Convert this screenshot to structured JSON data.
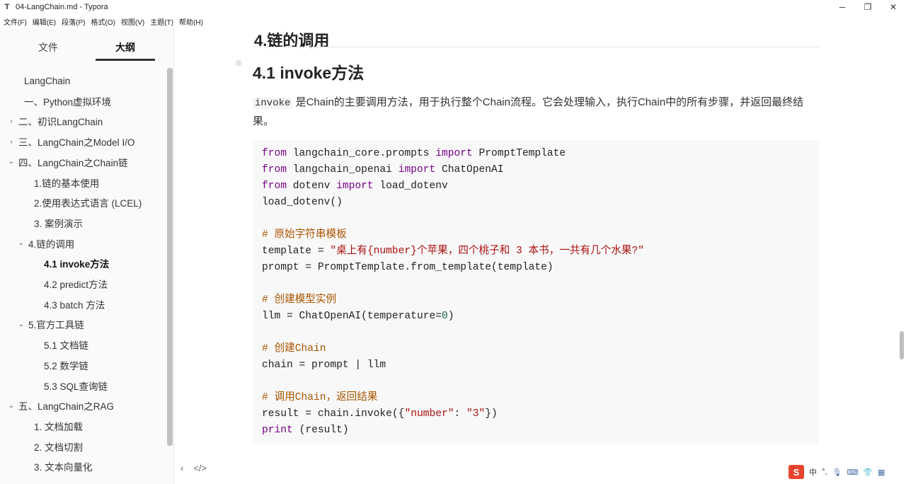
{
  "window": {
    "title": "04-LangChain.md - Typora",
    "app_icon": "T",
    "controls": [
      "minimize-icon",
      "maximize-icon",
      "close-icon"
    ]
  },
  "menubar": [
    "文件(F)",
    "编辑(E)",
    "段落(P)",
    "格式(O)",
    "视图(V)",
    "主题(T)",
    "帮助(H)"
  ],
  "sidebar": {
    "tabs": {
      "file": "文件",
      "outline": "大纲",
      "active": "outline"
    },
    "outline": [
      {
        "label": "LangChain",
        "level": 0,
        "chevron": ""
      },
      {
        "label": "一、Python虚拟环境",
        "level": 0,
        "chevron": ""
      },
      {
        "label": "二、初识LangChain",
        "level": 0,
        "chevron": "›"
      },
      {
        "label": "三、LangChain之Model I/O",
        "level": 0,
        "chevron": "›"
      },
      {
        "label": "四、LangChain之Chain链",
        "level": 0,
        "chevron": "⌄"
      },
      {
        "label": "1.链的基本使用",
        "level": 1,
        "chevron": ""
      },
      {
        "label": "2.使用表达式语言 (LCEL)",
        "level": 1,
        "chevron": ""
      },
      {
        "label": "3. 案例演示",
        "level": 1,
        "chevron": ""
      },
      {
        "label": "4.链的调用",
        "level": 1,
        "chevron": "⌄"
      },
      {
        "label": "4.1 invoke方法",
        "level": 2,
        "chevron": "",
        "active": true
      },
      {
        "label": "4.2 predict方法",
        "level": 2,
        "chevron": ""
      },
      {
        "label": "4.3 batch 方法",
        "level": 2,
        "chevron": ""
      },
      {
        "label": "5.官方工具链",
        "level": 1,
        "chevron": "⌄"
      },
      {
        "label": "5.1 文档链",
        "level": 2,
        "chevron": ""
      },
      {
        "label": "5.2 数学链",
        "level": 2,
        "chevron": ""
      },
      {
        "label": "5.3 SQL查询链",
        "level": 2,
        "chevron": ""
      },
      {
        "label": "五、LangChain之RAG",
        "level": 0,
        "chevron": "⌄"
      },
      {
        "label": "1. 文档加载",
        "level": 1,
        "chevron": ""
      },
      {
        "label": "2. 文档切割",
        "level": 1,
        "chevron": ""
      },
      {
        "label": "3. 文本向量化",
        "level": 1,
        "chevron": ""
      }
    ]
  },
  "doc": {
    "h1": "4.链的调用",
    "h2": "4.1 invoke方法",
    "para_code": "invoke",
    "para_text": " 是Chain的主要调用方法，用于执行整个Chain流程。它会处理输入，执行Chain中的所有步骤，并返回最终结果。",
    "code": [
      [
        [
          "kw",
          "from"
        ],
        [
          "",
          "langchain_core.prompts "
        ],
        [
          "kw",
          "import"
        ],
        [
          "",
          "PromptTemplate"
        ]
      ],
      [
        [
          "kw",
          "from"
        ],
        [
          "",
          "langchain_openai "
        ],
        [
          "kw",
          "import"
        ],
        [
          "",
          "ChatOpenAI"
        ]
      ],
      [
        [
          "kw",
          "from"
        ],
        [
          "",
          "dotenv "
        ],
        [
          "kw",
          "import"
        ],
        [
          "",
          "load_dotenv"
        ]
      ],
      [
        [
          "",
          "load_dotenv()"
        ]
      ],
      [],
      [
        [
          "cmt",
          "# 原始字符串模板"
        ]
      ],
      [
        [
          "",
          "template = "
        ],
        [
          "str",
          "\"桌上有{number}个苹果，四个桃子和 3 本书，一共有几个水果?\""
        ]
      ],
      [
        [
          "",
          "prompt = PromptTemplate.from_template(template)"
        ]
      ],
      [],
      [
        [
          "cmt",
          "# 创建模型实例"
        ]
      ],
      [
        [
          "",
          "llm = ChatOpenAI(temperature="
        ],
        [
          "num",
          "0"
        ],
        [
          "",
          ")"
        ]
      ],
      [],
      [
        [
          "cmt",
          "# 创建Chain"
        ]
      ],
      [
        [
          "",
          "chain = prompt | llm"
        ]
      ],
      [],
      [
        [
          "cmt",
          "# 调用Chain，返回结果"
        ]
      ],
      [
        [
          "",
          "result = chain.invoke({"
        ],
        [
          "str",
          "\"number\""
        ],
        [
          "",
          ": "
        ],
        [
          "str",
          "\"3\""
        ],
        [
          "",
          "})"
        ]
      ],
      [
        [
          "kw",
          "print"
        ],
        [
          "",
          "(result)"
        ]
      ]
    ]
  },
  "bottom_tools": [
    "‹",
    "</>"
  ],
  "ime": {
    "logo": "S",
    "lang": "中",
    "items": [
      "°,",
      "mic-icon",
      "keyboard-icon",
      "shirt-icon",
      "grid-icon"
    ]
  }
}
